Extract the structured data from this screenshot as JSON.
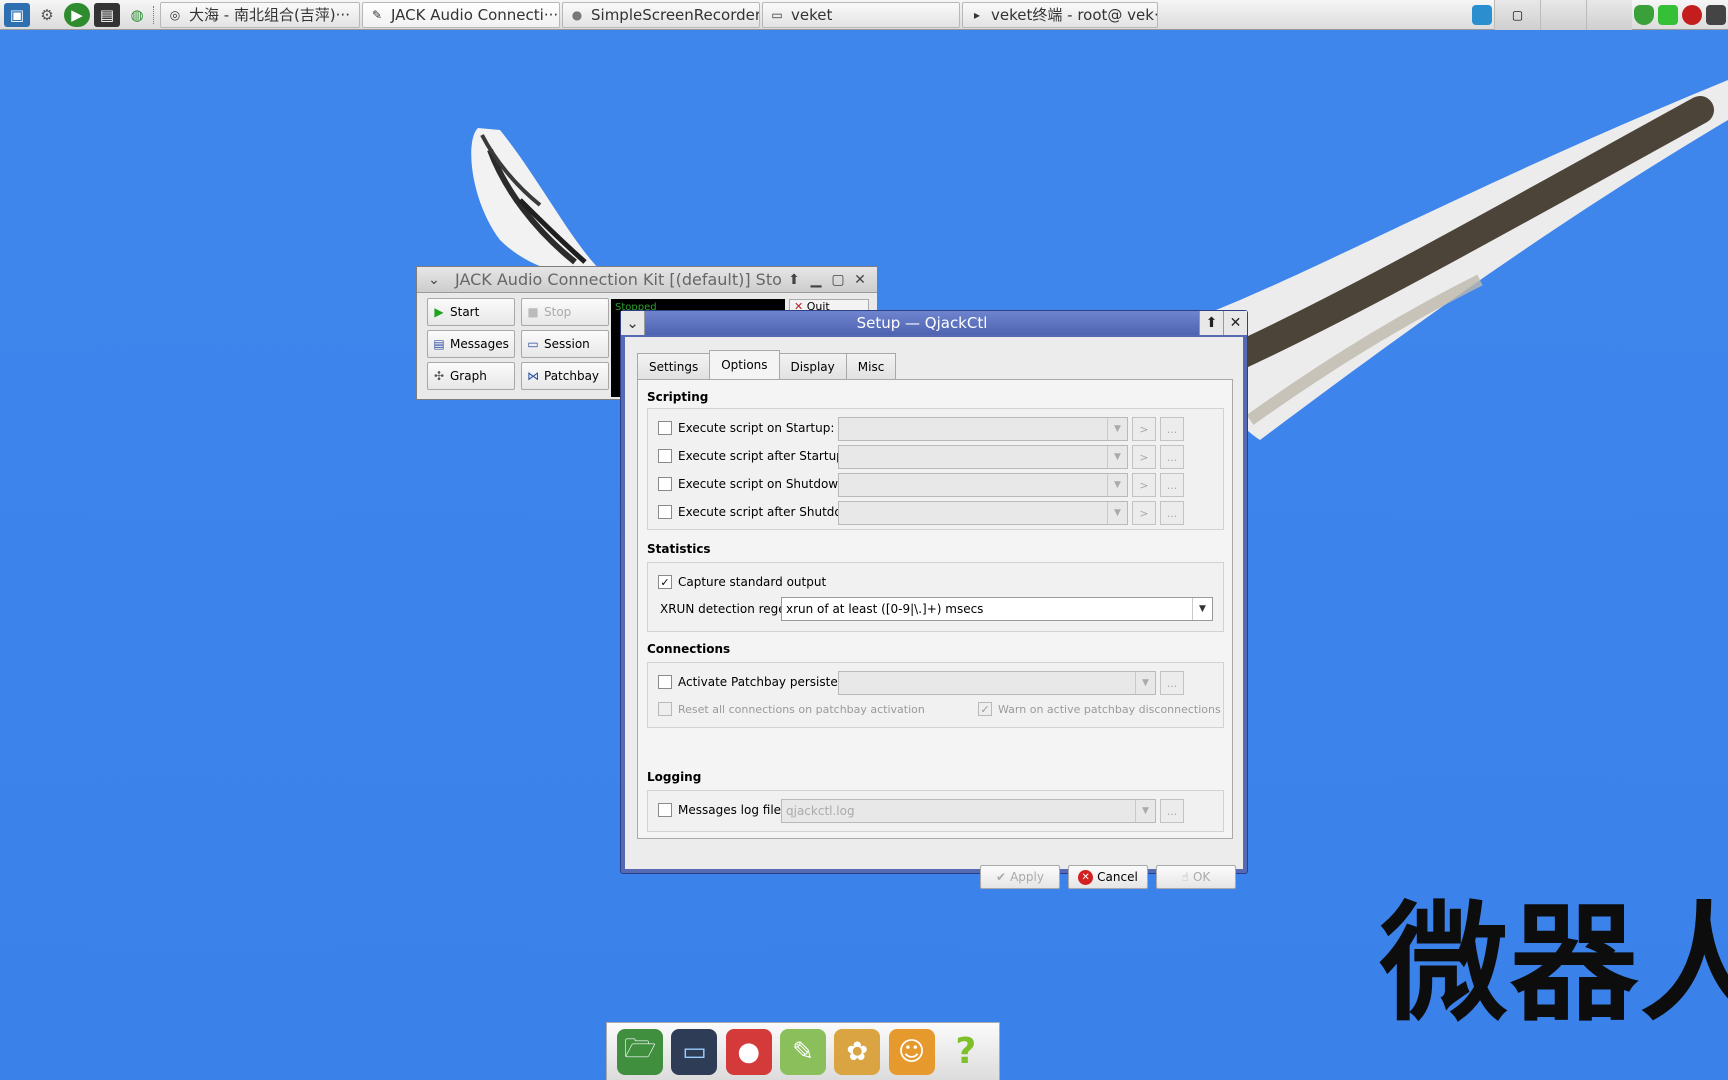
{
  "colors": {
    "desktop": "#3f86ec",
    "dialog_title": "#5569b5",
    "start_green": "#1fa31f",
    "cancel_red": "#d32020"
  },
  "taskbar": {
    "launchers": [
      "system-monitor-icon",
      "settings-icon",
      "play-icon",
      "terminal-icon",
      "globe-icon"
    ],
    "tasks": [
      {
        "label": "大海 - 南北组合(吉萍)···",
        "icon": "music-icon"
      },
      {
        "label": "JACK Audio Connecti···",
        "icon": "jack-icon"
      },
      {
        "label": "SimpleScreenRecorder",
        "icon": "recorder-icon"
      },
      {
        "label": "veket",
        "icon": "folder-icon"
      },
      {
        "label": "veket终端 - root@ vek···",
        "icon": "terminal-icon"
      }
    ]
  },
  "jack_window": {
    "title": "JACK Audio Connection Kit [(default)] Stoppe",
    "buttons": {
      "start": "Start",
      "stop": "Stop",
      "messages": "Messages",
      "session": "Session",
      "graph": "Graph",
      "patchbay": "Patchbay",
      "quit": "Quit"
    },
    "status": "Stopped"
  },
  "setup_dialog": {
    "title": "Setup — QjackCtl",
    "tabs": [
      {
        "label": "Settings",
        "active": false
      },
      {
        "label": "Options",
        "active": true
      },
      {
        "label": "Display",
        "active": false
      },
      {
        "label": "Misc",
        "active": false
      }
    ],
    "scripting": {
      "title": "Scripting",
      "rows": [
        {
          "label": "Execute script on Startup:",
          "checked": false
        },
        {
          "label": "Execute script after Startup:",
          "checked": false
        },
        {
          "label": "Execute script on Shutdown:",
          "checked": false
        },
        {
          "label": "Execute script after Shutdown:",
          "checked": false
        }
      ],
      "play_glyph": ">",
      "browse_glyph": "..."
    },
    "statistics": {
      "title": "Statistics",
      "capture_label": "Capture standard output",
      "capture_checked": true,
      "xrun_label": "XRUN detection regex:",
      "xrun_value": "xrun of at least ([0-9|\\.]+) msecs"
    },
    "connections": {
      "title": "Connections",
      "persistence_label": "Activate Patchbay persistence:",
      "persistence_checked": false,
      "reset_label": "Reset all connections on patchbay activation",
      "reset_checked": false,
      "warn_label": "Warn on active patchbay disconnections",
      "warn_checked": true
    },
    "logging": {
      "title": "Logging",
      "log_label": "Messages log file:",
      "log_checked": false,
      "log_value": "qjackctl.log"
    },
    "buttons": {
      "apply": "Apply",
      "cancel": "Cancel",
      "ok": "OK"
    }
  },
  "dock": {
    "items": [
      "file-manager-icon",
      "monitor-icon",
      "mascot-icon",
      "text-editor-icon",
      "paint-icon",
      "veket-mascot-icon",
      "help-icon"
    ]
  },
  "watermark": "微器人"
}
